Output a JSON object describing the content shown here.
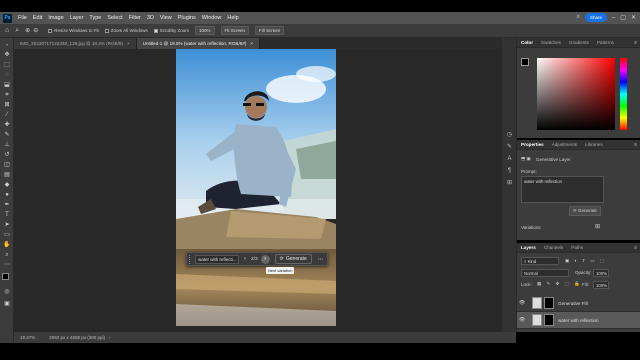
{
  "menubar": {
    "app_logo": "Ps",
    "items": [
      "File",
      "Edit",
      "Image",
      "Layer",
      "Type",
      "Select",
      "Filter",
      "3D",
      "View",
      "Plugins",
      "Window",
      "Help"
    ],
    "share_label": "Share"
  },
  "options_bar": {
    "resize_windows": "Resize Windows to Fit",
    "zoom_all": "Zoom All Windows",
    "scrubby_zoom": "Scrubby Zoom",
    "zoom_value": "100%",
    "fit_screen": "Fit Screen",
    "fill_screen": "Fill Screen"
  },
  "tabs": [
    {
      "label": "IMG_20230717122338_129.jpg @ 18.4% (RGB/8)"
    },
    {
      "label": "Untitled-1 @ 18.5% (water with reflection, RGB/8#)"
    }
  ],
  "contextual_bar": {
    "prompt": "water with reflecti...",
    "counter": "2/3",
    "generate_label": "Generate",
    "tooltip": "Next variation"
  },
  "status": {
    "zoom": "18.47%",
    "doc_info": "2592 px x 4608 px (300 ppi)"
  },
  "color_panel": {
    "tabs": [
      "Color",
      "Swatches",
      "Gradients",
      "Patterns"
    ]
  },
  "properties_panel": {
    "tabs": [
      "Properties",
      "Adjustments",
      "Libraries"
    ],
    "layer_type": "Generative Layer",
    "prompt_label": "Prompt:",
    "prompt_value": "water with reflection",
    "generate_label": "Generate",
    "variations_label": "Variations"
  },
  "layers_panel": {
    "tabs": [
      "Layers",
      "Channels",
      "Paths"
    ],
    "filter_kind": "Kind",
    "blend_mode": "Normal",
    "opacity_label": "Opacity:",
    "opacity_value": "100%",
    "lock_label": "Lock:",
    "fill_label": "Fill:",
    "fill_value": "100%",
    "layers": [
      {
        "name": "Generative Fill"
      },
      {
        "name": "water with reflection"
      }
    ]
  },
  "colors": {
    "accent": "#1473e6",
    "ui_dark": "#3c3c3c",
    "canvas": "#282828"
  }
}
